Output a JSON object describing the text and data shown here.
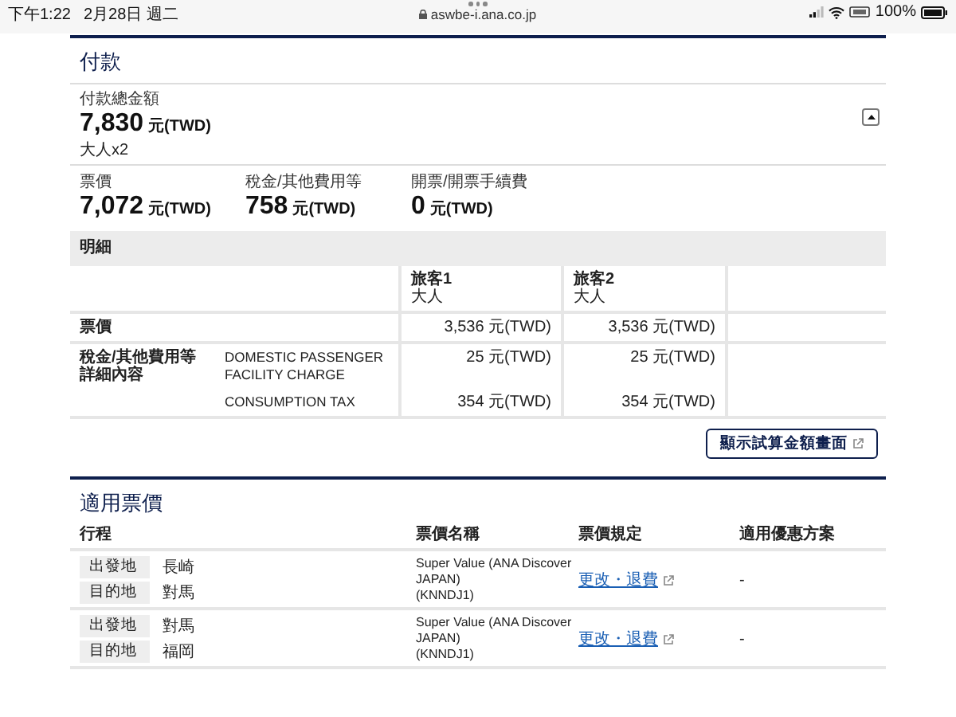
{
  "status_bar": {
    "time": "下午1:22",
    "date": "2月28日 週二",
    "url": "aswbe-i.ana.co.jp",
    "battery": "100%"
  },
  "payment": {
    "title": "付款",
    "total_label": "付款總金額",
    "total_amount": "7,830",
    "total_currency": "元(TWD)",
    "passengers": "大人x2",
    "expanded": true,
    "breakdown": [
      {
        "label": "票價",
        "amount": "7,072",
        "currency": "元(TWD)"
      },
      {
        "label": "稅金/其他費用等",
        "amount": "758",
        "currency": "元(TWD)"
      },
      {
        "label": "開票/開票手續費",
        "amount": "0",
        "currency": "元(TWD)"
      }
    ]
  },
  "details": {
    "title": "明細",
    "columns": [
      {
        "name": "旅客1",
        "type": "大人"
      },
      {
        "name": "旅客2",
        "type": "大人"
      }
    ],
    "rows": [
      {
        "label": "票價",
        "lines": [
          {
            "values": [
              "3,536 元(TWD)",
              "3,536 元(TWD)"
            ]
          }
        ]
      },
      {
        "label": "稅金/其他費用等詳細內容",
        "lines": [
          {
            "name": "DOMESTIC PASSENGER FACILITY CHARGE",
            "values": [
              "25 元(TWD)",
              "25 元(TWD)"
            ]
          },
          {
            "name": "CONSUMPTION TAX",
            "values": [
              "354 元(TWD)",
              "354 元(TWD)"
            ]
          }
        ]
      }
    ],
    "button": "顯示試算金額畫面"
  },
  "fares": {
    "title": "適用票價",
    "columns": [
      "行程",
      "票價名稱",
      "票價規定",
      "適用優惠方案"
    ],
    "rows": [
      {
        "origin_label": "出發地",
        "origin": "長崎",
        "dest_label": "目的地",
        "dest": "對馬",
        "fare_name": "Super Value (ANA Discover JAPAN)",
        "fare_code": "(KNNDJ1)",
        "rules_link": "更改・退費",
        "discount": "-"
      },
      {
        "origin_label": "出發地",
        "origin": "對馬",
        "dest_label": "目的地",
        "dest": "福岡",
        "fare_name": "Super Value (ANA Discover JAPAN)",
        "fare_code": "(KNNDJ1)",
        "rules_link": "更改・退費",
        "discount": "-"
      }
    ]
  }
}
